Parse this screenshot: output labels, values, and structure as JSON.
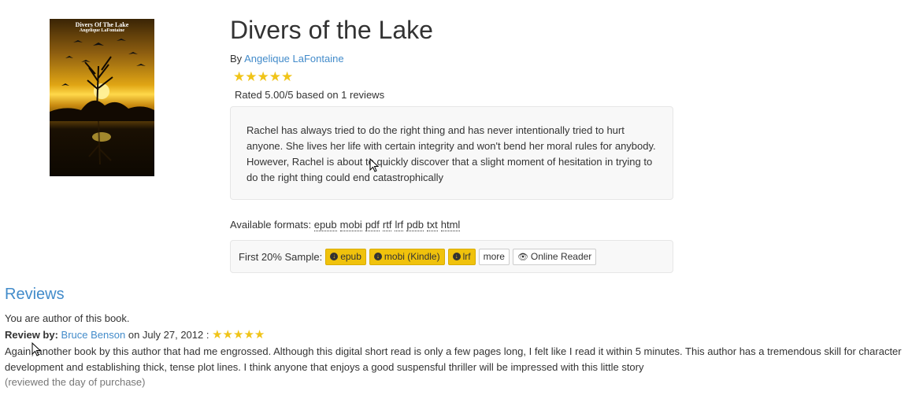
{
  "book": {
    "cover_title": "Divers Of The Lake",
    "cover_author": "Angelique LaFontaine",
    "title": "Divers of the Lake",
    "by_label": "By",
    "author": "Angelique LaFontaine",
    "rating_stars": "★★★★★",
    "rating_value": 5,
    "rating_text": "Rated 5.00/5 based on 1 reviews",
    "synopsis": "Rachel has always tried to do the right thing and has never intentionally tried to hurt anyone. She lives her life with certain integrity and won't bend her moral rules for anybody. However, Rachel is about to quickly discover that a slight moment of hesitation in trying to do the right thing could end catastrophically",
    "formats_label": "Available formats:",
    "formats": [
      "epub",
      "mobi",
      "pdf",
      "rtf",
      "lrf",
      "pdb",
      "txt",
      "html"
    ]
  },
  "sample": {
    "label": "First 20% Sample:",
    "epub_label": "epub",
    "mobi_label": "mobi (Kindle)",
    "lrf_label": "lrf",
    "more_label": "more",
    "reader_label": "Online Reader",
    "download_icon": "download-circle-icon",
    "reader_icon": "eye-icon"
  },
  "reviews": {
    "heading": "Reviews",
    "author_notice": "You are author of this book.",
    "review_by_label": "Review by:",
    "reviewer": "Bruce Benson",
    "date_text": "on July 27, 2012 :",
    "stars": "★★★★★",
    "body": "Again, another book by this author that had me engrossed. Although this digital short read is only a few pages long, I felt like I read it within 5 minutes. This author has a tremendous skill for character development and establishing thick, tense plot lines. I think anyone that enjoys a good suspensful thriller will be impressed with this little story",
    "note": "(reviewed the day of purchase)"
  },
  "colors": {
    "link": "#428bca",
    "star": "#f0c419",
    "sample_button": "#f0c20c"
  }
}
